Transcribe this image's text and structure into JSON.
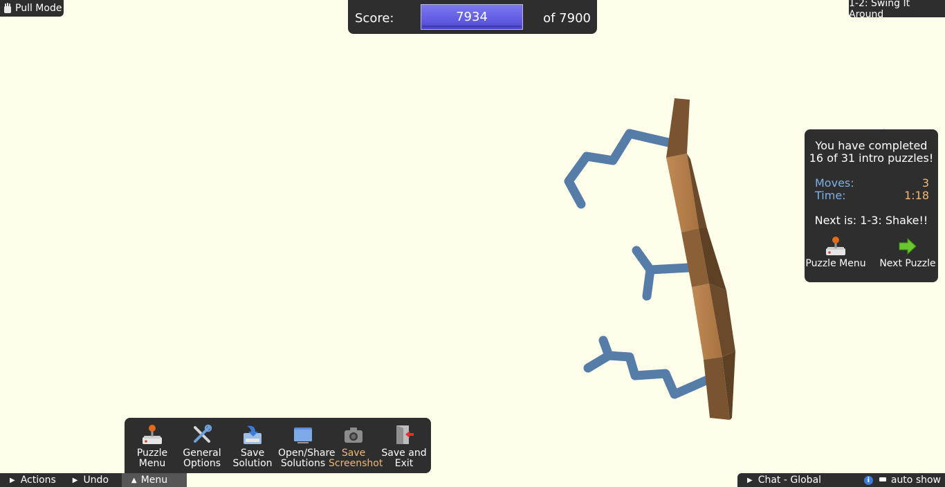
{
  "top_left": {
    "mode_label": "Pull Mode"
  },
  "score": {
    "label": "Score:",
    "value": "7934",
    "max_label": "of 7900"
  },
  "puzzle": {
    "name": "1-2: Swing It Around"
  },
  "completion": {
    "line1": "You have completed",
    "line2": "16 of 31 intro puzzles!",
    "moves_label": "Moves:",
    "moves_value": "3",
    "time_label": "Time:",
    "time_value": "1:18",
    "next_is": "Next is: 1-3: Shake!!",
    "puzzle_menu_label": "Puzzle Menu",
    "next_puzzle_label": "Next Puzzle"
  },
  "menu": {
    "items": [
      {
        "line1": "Puzzle",
        "line2": "Menu",
        "icon": "joystick-icon"
      },
      {
        "line1": "General",
        "line2": "Options",
        "icon": "tools-icon"
      },
      {
        "line1": "Save",
        "line2": "Solution",
        "icon": "save-icon"
      },
      {
        "line1": "Open/Share",
        "line2": "Solutions",
        "icon": "folder-icon"
      },
      {
        "line1": "Save",
        "line2": "Screenshot",
        "icon": "camera-icon"
      },
      {
        "line1": "Save and",
        "line2": "Exit",
        "icon": "exit-door-icon"
      }
    ]
  },
  "bottom_bar": {
    "actions_label": "Actions",
    "undo_label": "Undo",
    "menu_label": "Menu",
    "chat_label": "Chat - Global",
    "auto_show_label": "auto show"
  },
  "colors": {
    "background": "#FFFEEB",
    "panel": "#2E2E2E",
    "score_bar": "#6A64EA",
    "stat_label": "#7FB1E6",
    "stat_value": "#F2B878",
    "highlight": "#F2B878",
    "sidechain": "#5A7FAA",
    "backbone_light": "#B8834E",
    "backbone_dark": "#6B4A2C"
  }
}
